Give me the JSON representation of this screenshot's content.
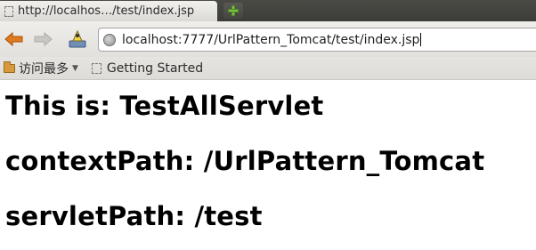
{
  "tab": {
    "title": "http://localhos…/test/index.jsp",
    "new_tab_icon": "plus-icon"
  },
  "toolbar": {
    "back_icon": "back-arrow-icon",
    "forward_icon": "forward-arrow-icon",
    "home_icon": "home-icon",
    "url": "localhost:7777/UrlPattern_Tomcat/test/index.jsp"
  },
  "bookmarks": {
    "most_visited": "访问最多",
    "getting_started": "Getting Started"
  },
  "page": {
    "lines": [
      "This is: TestAllServlet",
      "contextPath: /UrlPattern_Tomcat",
      "servletPath: /test"
    ]
  },
  "colors": {
    "tab_bar": "#3c3c38",
    "toolbar": "#e2e0dc",
    "back_arrow": "#e07a1f",
    "new_tab_plus": "#7ac143"
  }
}
